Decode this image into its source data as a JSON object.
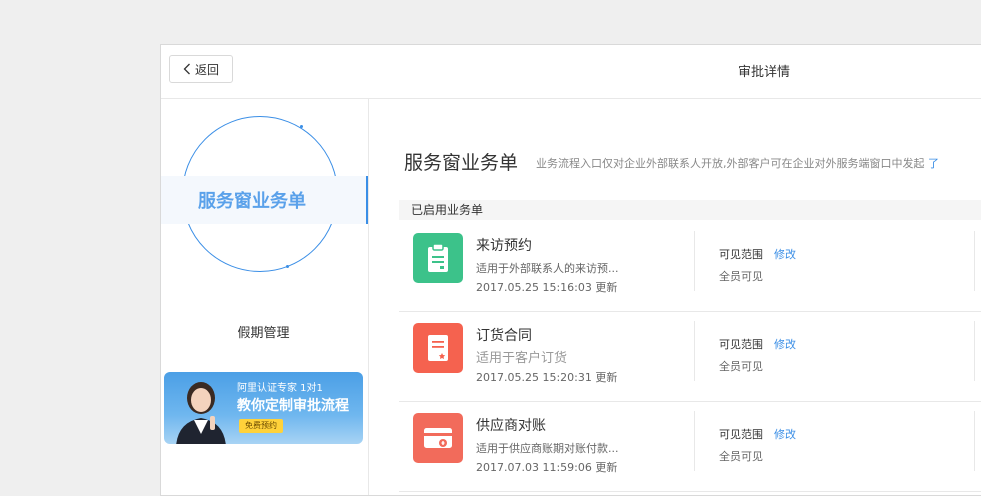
{
  "header": {
    "back_label": "返回",
    "title": "审批详情"
  },
  "sidebar": {
    "active_item": "服务窗业务单",
    "items": [
      {
        "label": "假期管理"
      }
    ],
    "banner": {
      "line1": "阿里认证专家 1对1",
      "line2": "教你定制审批流程",
      "cta": "免费预约"
    }
  },
  "main": {
    "title": "服务窗业务单",
    "description": "业务流程入口仅对企业外部联系人开放,外部客户可在企业对外服务端窗口中发起",
    "link": "了",
    "group_label": "已启用业务单",
    "forms": [
      {
        "name": "来访预约",
        "desc": "适用于外部联系人的来访预...",
        "time": "2017.05.25 15:16:03 更新",
        "scope_label": "可见范围",
        "edit_label": "修改",
        "scope_value": "全员可见",
        "icon": "clipboard-icon",
        "color": "#3cc28a"
      },
      {
        "name": "订货合同",
        "desc": "适用于客户订货",
        "time": "2017.05.25 15:20:31 更新",
        "scope_label": "可见范围",
        "edit_label": "修改",
        "scope_value": "全员可见",
        "icon": "contract-icon",
        "color": "#f5624f"
      },
      {
        "name": "供应商对账",
        "desc": "适用于供应商账期对账付款...",
        "time": "2017.07.03 11:59:06 更新",
        "scope_label": "可见范围",
        "edit_label": "修改",
        "scope_value": "全员可见",
        "icon": "card-icon",
        "color": "#f26b5b"
      }
    ]
  },
  "colors": {
    "accent": "#3a8ee6",
    "active_text": "#5aa1ea"
  }
}
